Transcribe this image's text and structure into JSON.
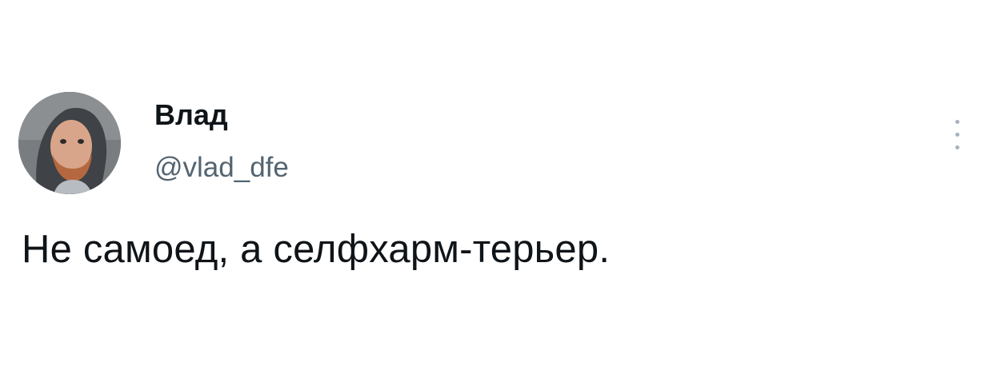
{
  "tweet": {
    "author": {
      "display_name": "Влад",
      "handle": "@vlad_dfe",
      "avatar": "profile-photo"
    },
    "text": "Не самоед, а селфхарм-терьер.",
    "menu_icon": "more-vertical-icon"
  },
  "colors": {
    "text_primary": "#0f1419",
    "text_secondary": "#536471",
    "background": "#ffffff"
  }
}
